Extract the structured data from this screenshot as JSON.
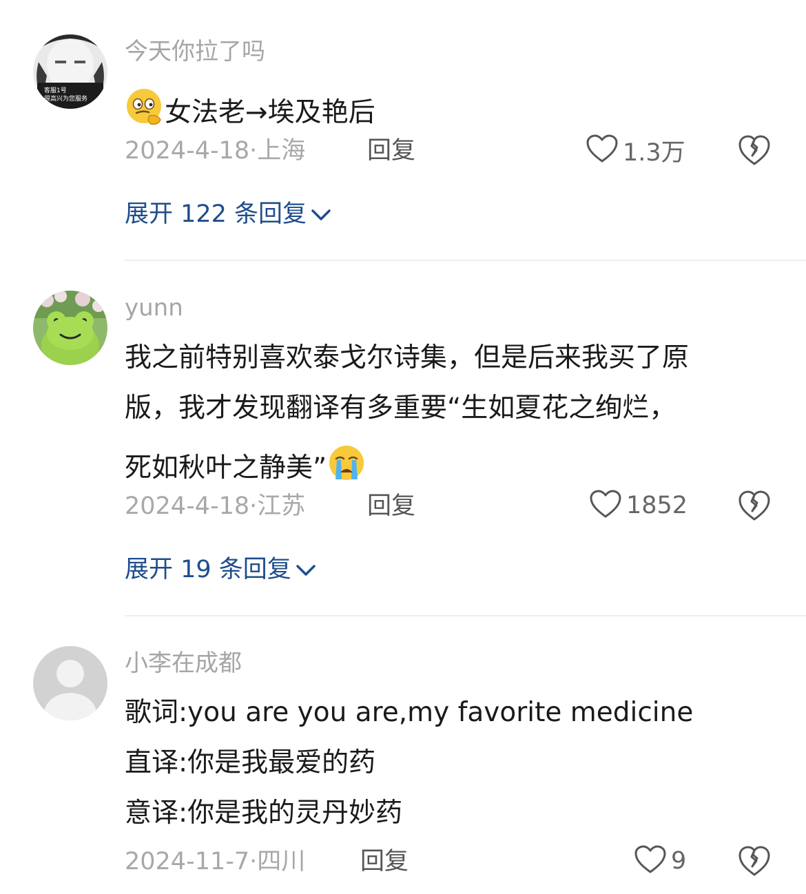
{
  "comments": [
    {
      "username": "今天你拉了吗",
      "avatar_text": [
        "客服1号",
        "很高兴为您服务"
      ],
      "content_lines": [
        "女法老→埃及艳后"
      ],
      "date": "2024-4-18",
      "location": "上海",
      "reply_label": "回复",
      "likes": "1.3万",
      "expand_label": "展开 122 条回复",
      "lead_emoji": "thinking-face-emoji"
    },
    {
      "username": "yunn",
      "content_lines": [
        "我之前特别喜欢泰戈尔诗集，但是后来我买了原",
        "版，我才发现翻译有多重要“生如夏花之绚烂，",
        "死如秋叶之静美”"
      ],
      "date": "2024-4-18",
      "location": "江苏",
      "reply_label": "回复",
      "likes": "1852",
      "expand_label": "展开 19 条回复",
      "trail_emoji": "crying-face-emoji"
    },
    {
      "username": "小李在成都",
      "content_lines": [
        "歌词:you are you are,my favorite medicine",
        "直译:你是我最爱的药",
        "意译:你是我的灵丹妙药"
      ],
      "date": "2024-11-7",
      "location": "四川",
      "reply_label": "回复",
      "likes": "9"
    }
  ],
  "colors": {
    "username": "#a5a5a5",
    "content": "#1a1a1a",
    "meta": "#a8a8a8",
    "expand_link": "#1e4d8c",
    "divider": "#eeeeee"
  }
}
